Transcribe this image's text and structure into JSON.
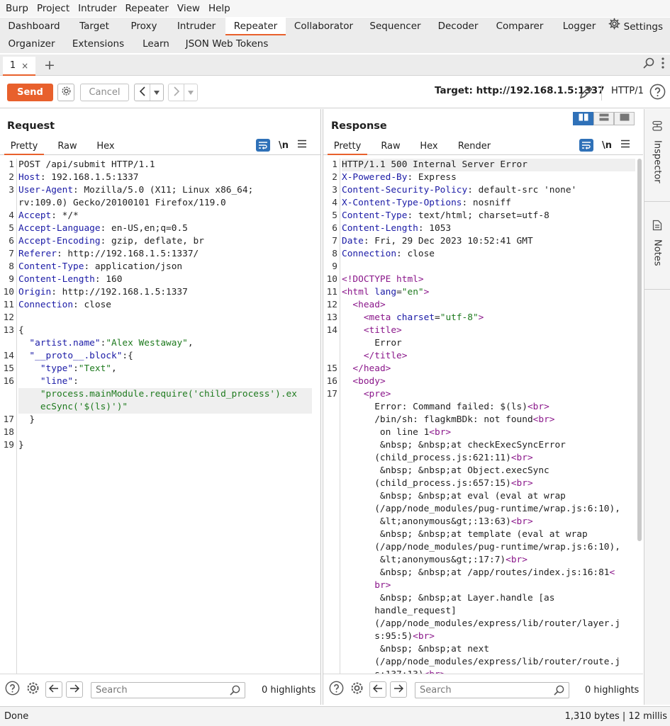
{
  "menu": [
    "Burp",
    "Project",
    "Intruder",
    "Repeater",
    "View",
    "Help"
  ],
  "tool_tabs_row1": [
    {
      "label": "Dashboard",
      "active": false
    },
    {
      "label": "Target",
      "active": false
    },
    {
      "label": "Proxy",
      "active": false
    },
    {
      "label": "Intruder",
      "active": false
    },
    {
      "label": "Repeater",
      "active": true
    },
    {
      "label": "Collaborator",
      "active": false
    },
    {
      "label": "Sequencer",
      "active": false
    },
    {
      "label": "Decoder",
      "active": false
    },
    {
      "label": "Comparer",
      "active": false
    },
    {
      "label": "Logger",
      "active": false
    }
  ],
  "settings_label": "Settings",
  "tool_tabs_row2": [
    "Organizer",
    "Extensions",
    "Learn",
    "JSON Web Tokens"
  ],
  "repeater_tab": {
    "label": "1",
    "close": "×",
    "add": "+"
  },
  "toolbar": {
    "send": "Send",
    "cancel": "Cancel",
    "target": "Target: http://192.168.1.5:1337",
    "http_version": "HTTP/1"
  },
  "request": {
    "title": "Request",
    "tabs": [
      "Pretty",
      "Raw",
      "Hex"
    ],
    "newline_label": "\\n"
  },
  "response": {
    "title": "Response",
    "tabs": [
      "Pretty",
      "Raw",
      "Hex",
      "Render"
    ],
    "newline_label": "\\n"
  },
  "bottom": {
    "search_placeholder": "Search",
    "highlights": "0 highlights"
  },
  "inspector": {
    "inspector": "Inspector",
    "notes": "Notes"
  },
  "status": {
    "left": "Done",
    "right": "1,310 bytes | 12 millis"
  },
  "colors": {
    "accent": "#e8602c",
    "selected_blue": "#2f71b8"
  }
}
